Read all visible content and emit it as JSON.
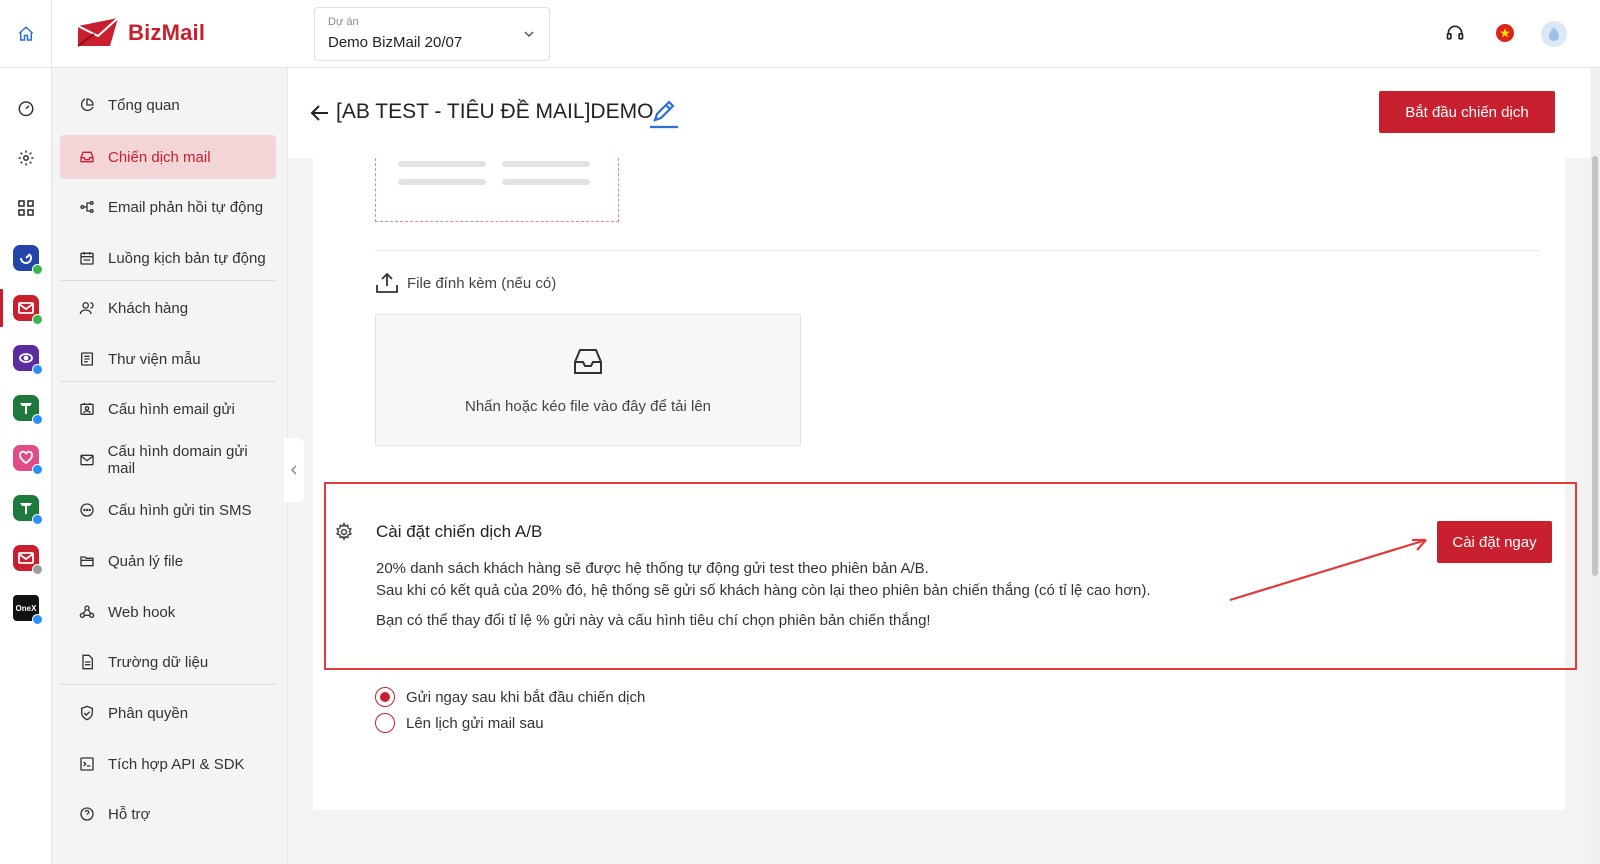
{
  "topbar": {
    "logo_text": "BizMail",
    "project_label": "Dự án",
    "project_value": "Demo BizMail 20/07",
    "icons": [
      "home-icon",
      "headset-icon",
      "vietnam-flag-icon",
      "user-avatar-icon"
    ]
  },
  "rail": {
    "icons": [
      "dashboard-icon",
      "gear-icon",
      "grid-icon",
      "app-bizfly-icon",
      "app-bizmail-icon",
      "app-chatbot-icon",
      "app-tasks-icon",
      "app-care-icon",
      "app-tasks2-icon",
      "app-bizmail2-icon",
      "app-onex-icon"
    ],
    "onex_label": "OneX"
  },
  "sidebar": {
    "items": [
      {
        "label": "Tổng quan",
        "icon": "pie-chart-icon"
      },
      {
        "label": "Chiến dịch mail",
        "icon": "inbox-icon",
        "active": true
      },
      {
        "label": "Email phản hồi tự động",
        "icon": "flow-icon"
      },
      {
        "label": "Luồng kịch bản tự động",
        "icon": "calendar-flow-icon"
      },
      {
        "label": "Khách hàng",
        "icon": "users-icon"
      },
      {
        "label": "Thư viện mẫu",
        "icon": "template-icon"
      },
      {
        "label": "Cấu hình email gửi",
        "icon": "contact-card-icon"
      },
      {
        "label": "Cấu hình domain gửi mail",
        "icon": "mail-icon"
      },
      {
        "label": "Cấu hình gửi tin SMS",
        "icon": "sms-icon"
      },
      {
        "label": "Quản lý file",
        "icon": "folder-icon"
      },
      {
        "label": "Web hook",
        "icon": "webhook-icon"
      },
      {
        "label": "Trường dữ liệu",
        "icon": "file-text-icon"
      },
      {
        "label": "Phân quyền",
        "icon": "shield-check-icon"
      },
      {
        "label": "Tích hợp API & SDK",
        "icon": "terminal-icon"
      },
      {
        "label": "Hỗ trợ",
        "icon": "help-icon"
      }
    ]
  },
  "header": {
    "title": "[AB TEST - TIÊU ĐỀ MAIL]DEMO",
    "start_button": "Bắt đầu chiến dịch"
  },
  "attachment": {
    "label": "File đính kèm (nếu có)",
    "dropzone_text": "Nhấn hoặc kéo file vào đây để tải lên"
  },
  "ab_settings": {
    "title": "Cài đặt chiến dịch A/B",
    "line1": "20% danh sách khách hàng sẽ được hệ thống tự động gửi test theo phiên bản A/B.",
    "line2": "Sau khi có kết quả của 20% đó, hệ thống sẽ gửi số khách hàng còn lại theo phiên bản chiến thắng (có tỉ lệ cao hơn).",
    "line3": "Bạn có thể thay đổi tỉ lệ % gửi này và cấu hình tiêu chí chọn phiên bản chiến thắng!",
    "button": "Cài đặt ngay"
  },
  "schedule": {
    "options": [
      {
        "label": "Gửi ngay sau khi bắt đầu chiến dịch",
        "selected": true
      },
      {
        "label": "Lên lịch gửi mail sau",
        "selected": false
      }
    ]
  },
  "colors": {
    "brand": "#c8202f",
    "active_bg": "#f3d4d7",
    "highlight_border": "#e23a3a"
  }
}
